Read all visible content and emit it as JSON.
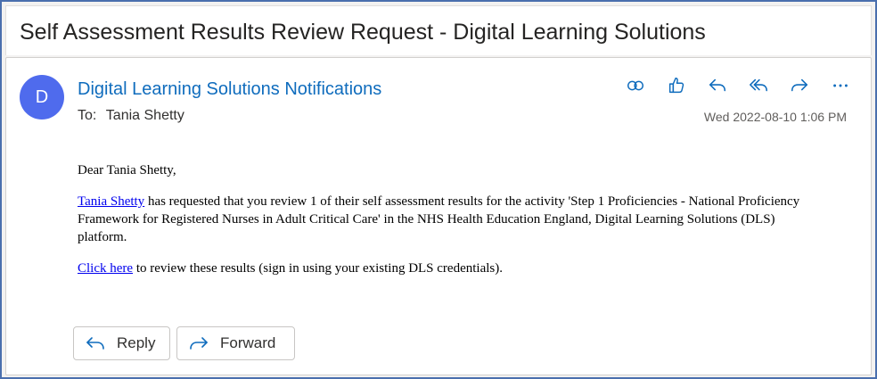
{
  "email": {
    "subject": "Self Assessment Results Review Request - Digital Learning Solutions",
    "avatar_initial": "D",
    "sender": "Digital Learning Solutions Notifications",
    "to_label": "To:",
    "to_name": "Tania Shetty",
    "date": "Wed 2022-08-10 1:06 PM",
    "body": {
      "greeting": "Dear Tania Shetty,",
      "para1_link": "Tania Shetty",
      "para1_text": " has requested that you review 1 of their self assessment results for the activity 'Step 1 Proficiencies - National Proficiency Framework for Registered Nurses in Adult Critical Care' in the NHS Health Education England, Digital Learning Solutions (DLS) platform.",
      "para2_link": "Click here",
      "para2_text": " to review these results (sign in using your existing DLS credentials)."
    }
  },
  "toolbar_icons": [
    "loop-icon",
    "like-icon",
    "reply-icon",
    "reply-all-icon",
    "forward-icon",
    "more-icon"
  ],
  "buttons": {
    "reply_label": "Reply",
    "forward_label": "Forward"
  },
  "colors": {
    "accent": "#0f6cbd",
    "avatar": "#4f6bed",
    "frame_border": "#4a6fae"
  }
}
